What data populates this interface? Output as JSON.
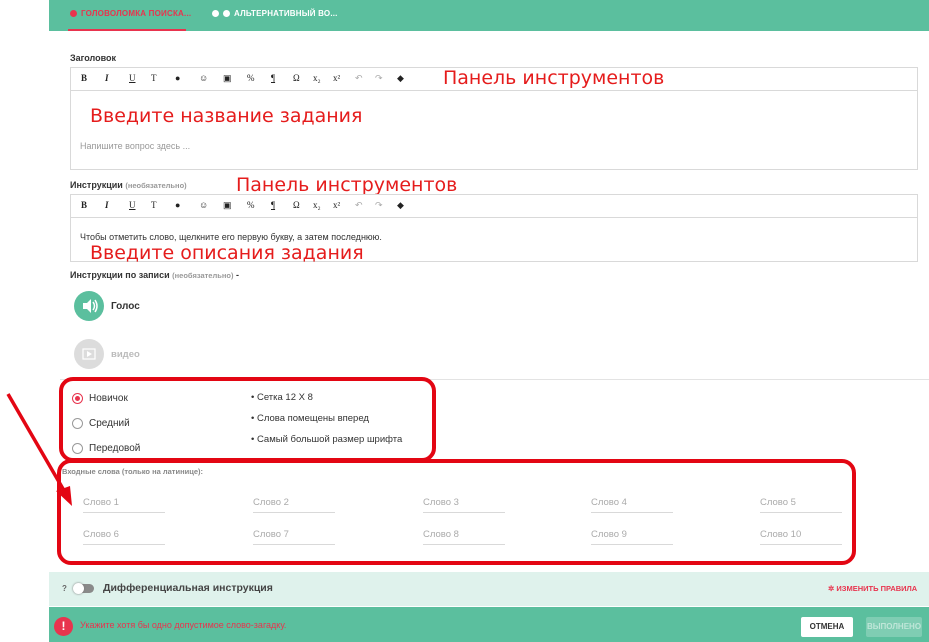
{
  "tabs": [
    {
      "label": "ГОЛОВОЛОМКА ПОИСКА..."
    },
    {
      "label": "АЛЬТЕРНАТИВНЫЙ ВО..."
    }
  ],
  "title_section": {
    "label": "Заголовок",
    "annotation_toolbar": "Панель инструментов",
    "annotation_body": "Введите название задания",
    "placeholder": "Напишите вопрос здесь ..."
  },
  "instructions_section": {
    "label": "Инструкции",
    "optional": "(необязательно)",
    "annotation_toolbar": "Панель инструментов",
    "text": "Чтобы отметить слово, щелкните его первую букву, а затем последнюю.",
    "annotation_body": "Введите описания задания"
  },
  "toolbar": {
    "bold": "B",
    "italic": "I",
    "underline": "U",
    "text_style": "T",
    "omega": "Ω",
    "subscript": "x₂",
    "superscript": "x²"
  },
  "record_section": {
    "label": "Инструкции по записи",
    "optional": "(необязательно)",
    "dash": "-",
    "voice_label": "Голос",
    "video_label": "видео"
  },
  "difficulty": {
    "options": [
      "Новичок",
      "Средний",
      "Передовой"
    ],
    "selected": "Новичок",
    "details": [
      "Сетка 12 X 8",
      "Слова помещены вперед",
      "Самый большой размер шрифта"
    ]
  },
  "words_section": {
    "label": "Входные слова (только на латинице):",
    "placeholders": [
      "Слово 1",
      "Слово 2",
      "Слово 3",
      "Слово 4",
      "Слово 5",
      "Слово 6",
      "Слово 7",
      "Слово 8",
      "Слово 9",
      "Слово 10"
    ]
  },
  "differential": {
    "question_mark": "?",
    "label": "Дифференциальная инструкция",
    "change_rules": "ИЗМЕНИТЬ ПРАВИЛА"
  },
  "footer": {
    "error_message": "Укажите хотя бы одно допустимое слово-загадку.",
    "error_icon_glyph": "!",
    "cancel": "ОТМЕНА",
    "done": "ВЫПОЛНЕНО"
  },
  "colors": {
    "accent_green": "#5bbf9e",
    "accent_red": "#e8344e",
    "annotation_red": "#e51c1c"
  }
}
